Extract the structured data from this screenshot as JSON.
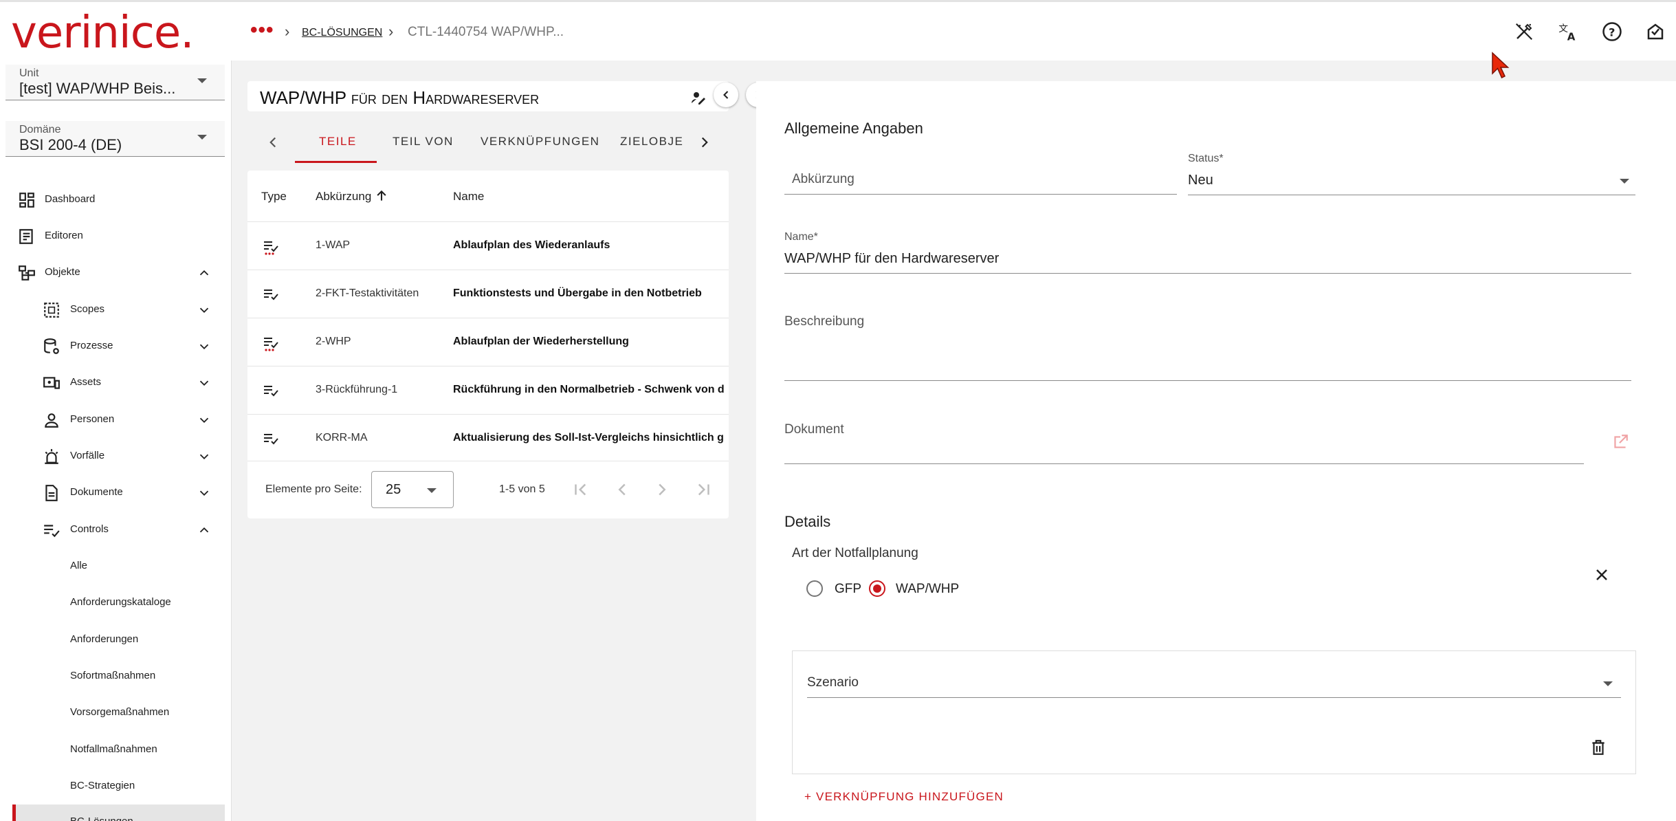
{
  "app": {
    "logo": "verinice."
  },
  "breadcrumb": {
    "more": "•••",
    "sep": "›",
    "link": "BC-Lösungen",
    "current": "CTL-1440754 WAP/WHP..."
  },
  "topbar_icons": [
    "auto-fix-off-icon",
    "translate-icon",
    "help-icon",
    "inbox-icon"
  ],
  "sidebar": {
    "unit": {
      "label": "Unit",
      "value": "[test] WAP/WHP Beis..."
    },
    "domain": {
      "label": "Domäne",
      "value": "BSI 200-4 (DE)"
    },
    "nav": [
      {
        "label": "Dashboard",
        "icon": "dashboard-icon"
      },
      {
        "label": "Editoren",
        "icon": "editor-icon"
      },
      {
        "label": "Objekte",
        "icon": "objects-icon"
      },
      {
        "label": "Scopes",
        "icon": "scope-icon"
      },
      {
        "label": "Prozesse",
        "icon": "process-icon"
      },
      {
        "label": "Assets",
        "icon": "asset-icon"
      },
      {
        "label": "Personen",
        "icon": "person-icon"
      },
      {
        "label": "Vorfälle",
        "icon": "incident-icon"
      },
      {
        "label": "Dokumente",
        "icon": "document-icon"
      },
      {
        "label": "Controls",
        "icon": "controls-icon"
      },
      {
        "label": "Alle"
      },
      {
        "label": "Anforderungskataloge"
      },
      {
        "label": "Anforderungen"
      },
      {
        "label": "Sofortmaßnahmen"
      },
      {
        "label": "Vorsorgemaßnahmen"
      },
      {
        "label": "Notfallmaßnahmen"
      },
      {
        "label": "BC-Strategien"
      },
      {
        "label": "BC-Lösungen"
      }
    ]
  },
  "object": {
    "title": "WAP/WHP für den Hardwareserver",
    "tabs": [
      "Teile",
      "Teil von",
      "Verknüpfungen",
      "Zielobje"
    ],
    "active_tab": "Teile",
    "columns": {
      "type": "Type",
      "abbr": "Abkürzung",
      "name": "Name"
    },
    "rows": [
      {
        "abbr": "1-WAP",
        "name": "Ablaufplan des Wiederanlaufs",
        "status": "red"
      },
      {
        "abbr": "2-FKT-Testaktivitäten",
        "name": "Funktionstests und Übergabe in den Notbetrieb",
        "status": "none"
      },
      {
        "abbr": "2-WHP",
        "name": "Ablaufplan der Wiederherstellung",
        "status": "red"
      },
      {
        "abbr": "3-Rückführung-1",
        "name": "Rückführung in den Normalbetrieb - Schwenk von d",
        "status": "none"
      },
      {
        "abbr": "KORR-MA",
        "name": "Aktualisierung des Soll-Ist-Vergleichs hinsichtlich g",
        "status": "none"
      }
    ],
    "pager": {
      "label": "Elemente pro Seite:",
      "per_page": "25",
      "range": "1-5 von 5"
    }
  },
  "form": {
    "general_heading": "Allgemeine Angaben",
    "abbr_placeholder": "Abkürzung",
    "status_label": "Status*",
    "status_value": "Neu",
    "name_label": "Name*",
    "name_value": "WAP/WHP für den Hardwareserver",
    "description_label": "Beschreibung",
    "document_label": "Dokument",
    "details_heading": "Details",
    "planning_label": "Art der Notfallplanung",
    "planning_options": [
      "GFP",
      "WAP/WHP"
    ],
    "planning_selected": "WAP/WHP",
    "scenario_label": "Szenario",
    "add_link": "+   VERKNÜPFUNG HINZUFÜGEN"
  },
  "colors": {
    "brand": "#c9161c",
    "background": "#f2f2f2"
  }
}
